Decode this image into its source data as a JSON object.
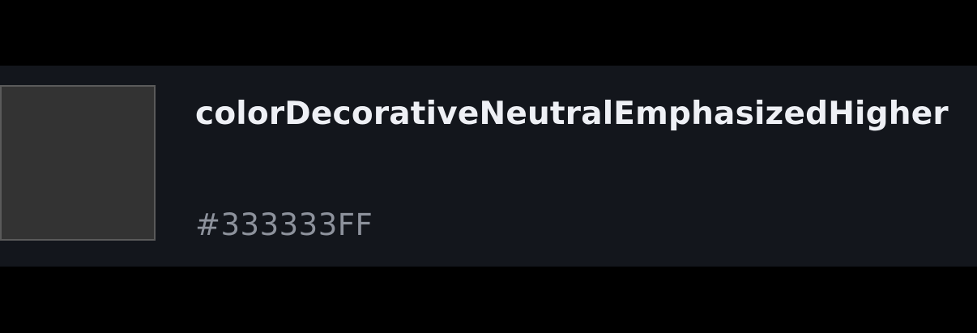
{
  "token": {
    "name": "colorDecorativeNeutralEmphasizedHigher",
    "value": "#333333FF",
    "swatch_color": "#333333",
    "swatch_border_color": "#5a5a5a"
  },
  "colors": {
    "page_background": "#000000",
    "row_background": "#13161c",
    "name_text": "#eef0f5",
    "value_text": "#8d929c"
  }
}
